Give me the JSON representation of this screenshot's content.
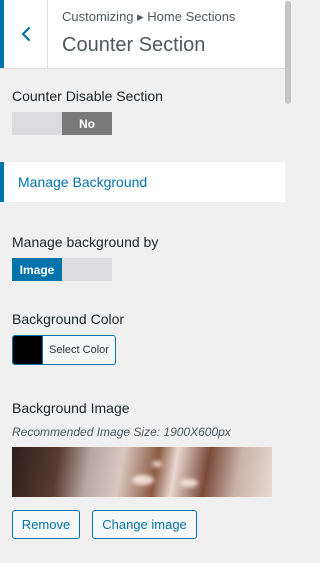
{
  "header": {
    "breadcrumb": "Customizing ▸ Home Sections",
    "title": "Counter Section"
  },
  "counter_disable": {
    "label": "Counter Disable Section",
    "selected": "No"
  },
  "manage_background": {
    "heading": "Manage Background"
  },
  "manage_by": {
    "label": "Manage background by",
    "selected": "Image"
  },
  "background_color": {
    "label": "Background Color",
    "button_label": "Select Color",
    "value": "#000000"
  },
  "background_image": {
    "label": "Background Image",
    "hint": "Recommended Image Size: 1900X600px",
    "remove_label": "Remove",
    "change_label": "Change image"
  },
  "colors": {
    "accent": "#0073aa",
    "toggle_on_gray": "#7a7a7a",
    "toggle_off": "#dcdcde"
  }
}
